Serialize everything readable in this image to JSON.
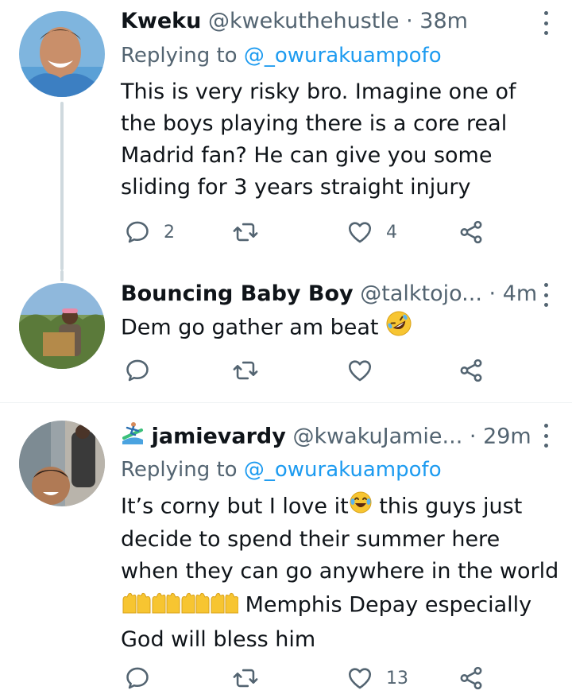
{
  "tweets": [
    {
      "name": "Kweku",
      "handle": "@kwekuthehustle",
      "separator": "·",
      "time": "38m",
      "replying_prefix": "Replying to",
      "replying_handle": "@_owurakuampofo",
      "text": "This is very risky bro. Imagine one of the boys playing there is a core real Madrid fan? He can give you some sliding for 3 years straight injury",
      "replies": "2",
      "retweets": "",
      "likes": "4"
    },
    {
      "name": "Bouncing Baby Boy",
      "handle": "@talktojo...",
      "separator": "·",
      "time": "4m",
      "text": "Dem go gather am beat",
      "text_emoji": "rolling-on-floor-laughing",
      "replies": "",
      "retweets": "",
      "likes": ""
    },
    {
      "name_emoji": "surfer",
      "name": "jamievardy",
      "handle": "@kwakuJamie...",
      "separator": "·",
      "time": "29m",
      "replying_prefix": "Replying to",
      "replying_handle": "@_owurakuampofo",
      "text_line1a": "It’s corny but I love it",
      "text_line1b": " this guys just",
      "text_line2": "decide to spend their summer here",
      "text_line3": "when they can go anywhere in the world",
      "text_line4": " Memphis Depay especially",
      "text_line5": "God will bless him",
      "replies": "",
      "retweets": "",
      "likes": "13"
    }
  ],
  "colors": {
    "text": "#0f1419",
    "secondary": "#536471",
    "link": "#1d9bf0",
    "thread": "#cfd9de"
  }
}
